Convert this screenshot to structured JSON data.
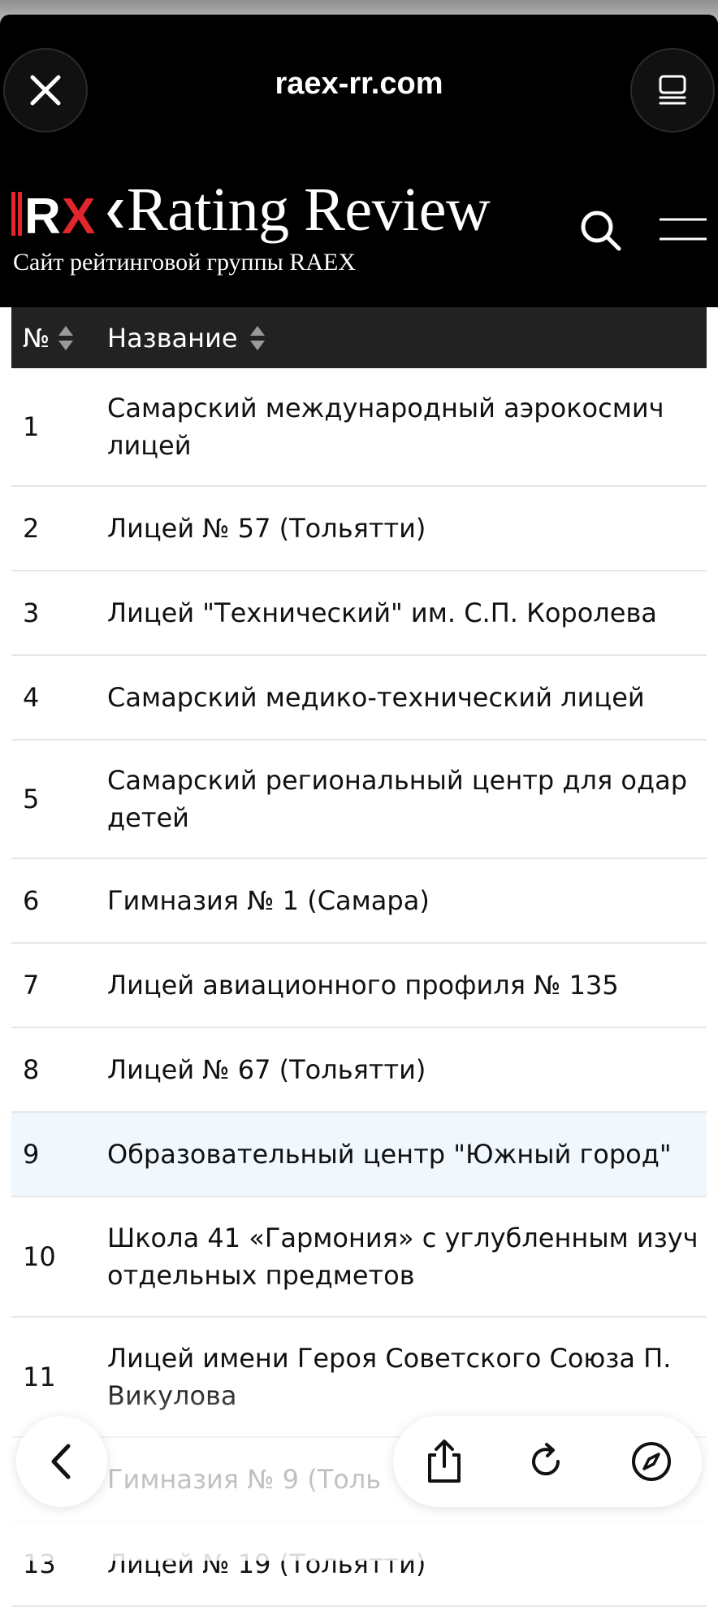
{
  "browser": {
    "url": "raex-rr.com",
    "icons": [
      "close-icon",
      "reader-mode-icon"
    ]
  },
  "site": {
    "logo_mark": "RX",
    "title": "Rating Review",
    "subtitle": "Сайт рейтинговой группы RAEX",
    "icons": [
      "search-icon",
      "menu-icon"
    ],
    "colors": {
      "brand_red": "#e3262d",
      "header_bg": "#000000"
    }
  },
  "table": {
    "columns": [
      "№",
      "Название"
    ],
    "rows": [
      {
        "num": "1",
        "name": "Самарский международный аэрокосмич\nлицей"
      },
      {
        "num": "2",
        "name": "Лицей № 57 (Тольятти)"
      },
      {
        "num": "3",
        "name": "Лицей \"Технический\" им. С.П. Королева"
      },
      {
        "num": "4",
        "name": "Самарский медико-технический лицей"
      },
      {
        "num": "5",
        "name": "Самарский региональный центр для одар\nдетей"
      },
      {
        "num": "6",
        "name": "Гимназия № 1 (Самара)"
      },
      {
        "num": "7",
        "name": "Лицей авиационного профиля № 135"
      },
      {
        "num": "8",
        "name": "Лицей № 67 (Тольятти)"
      },
      {
        "num": "9",
        "name": "Образовательный центр \"Южный город\""
      },
      {
        "num": "10",
        "name": "Школа 41 «Гармония» с углубленным изуч\nотдельных предметов"
      },
      {
        "num": "11",
        "name": "Лицей имени Героя Советского Союза П.\nВикулова"
      },
      {
        "num": "",
        "name": "Гимназия № 9 (Толь"
      },
      {
        "num": "13",
        "name": "Лицей № 19 (Тольятти)"
      }
    ]
  },
  "toolbar": {
    "icons": [
      "back-icon",
      "share-icon",
      "reload-icon",
      "compass-icon"
    ]
  }
}
